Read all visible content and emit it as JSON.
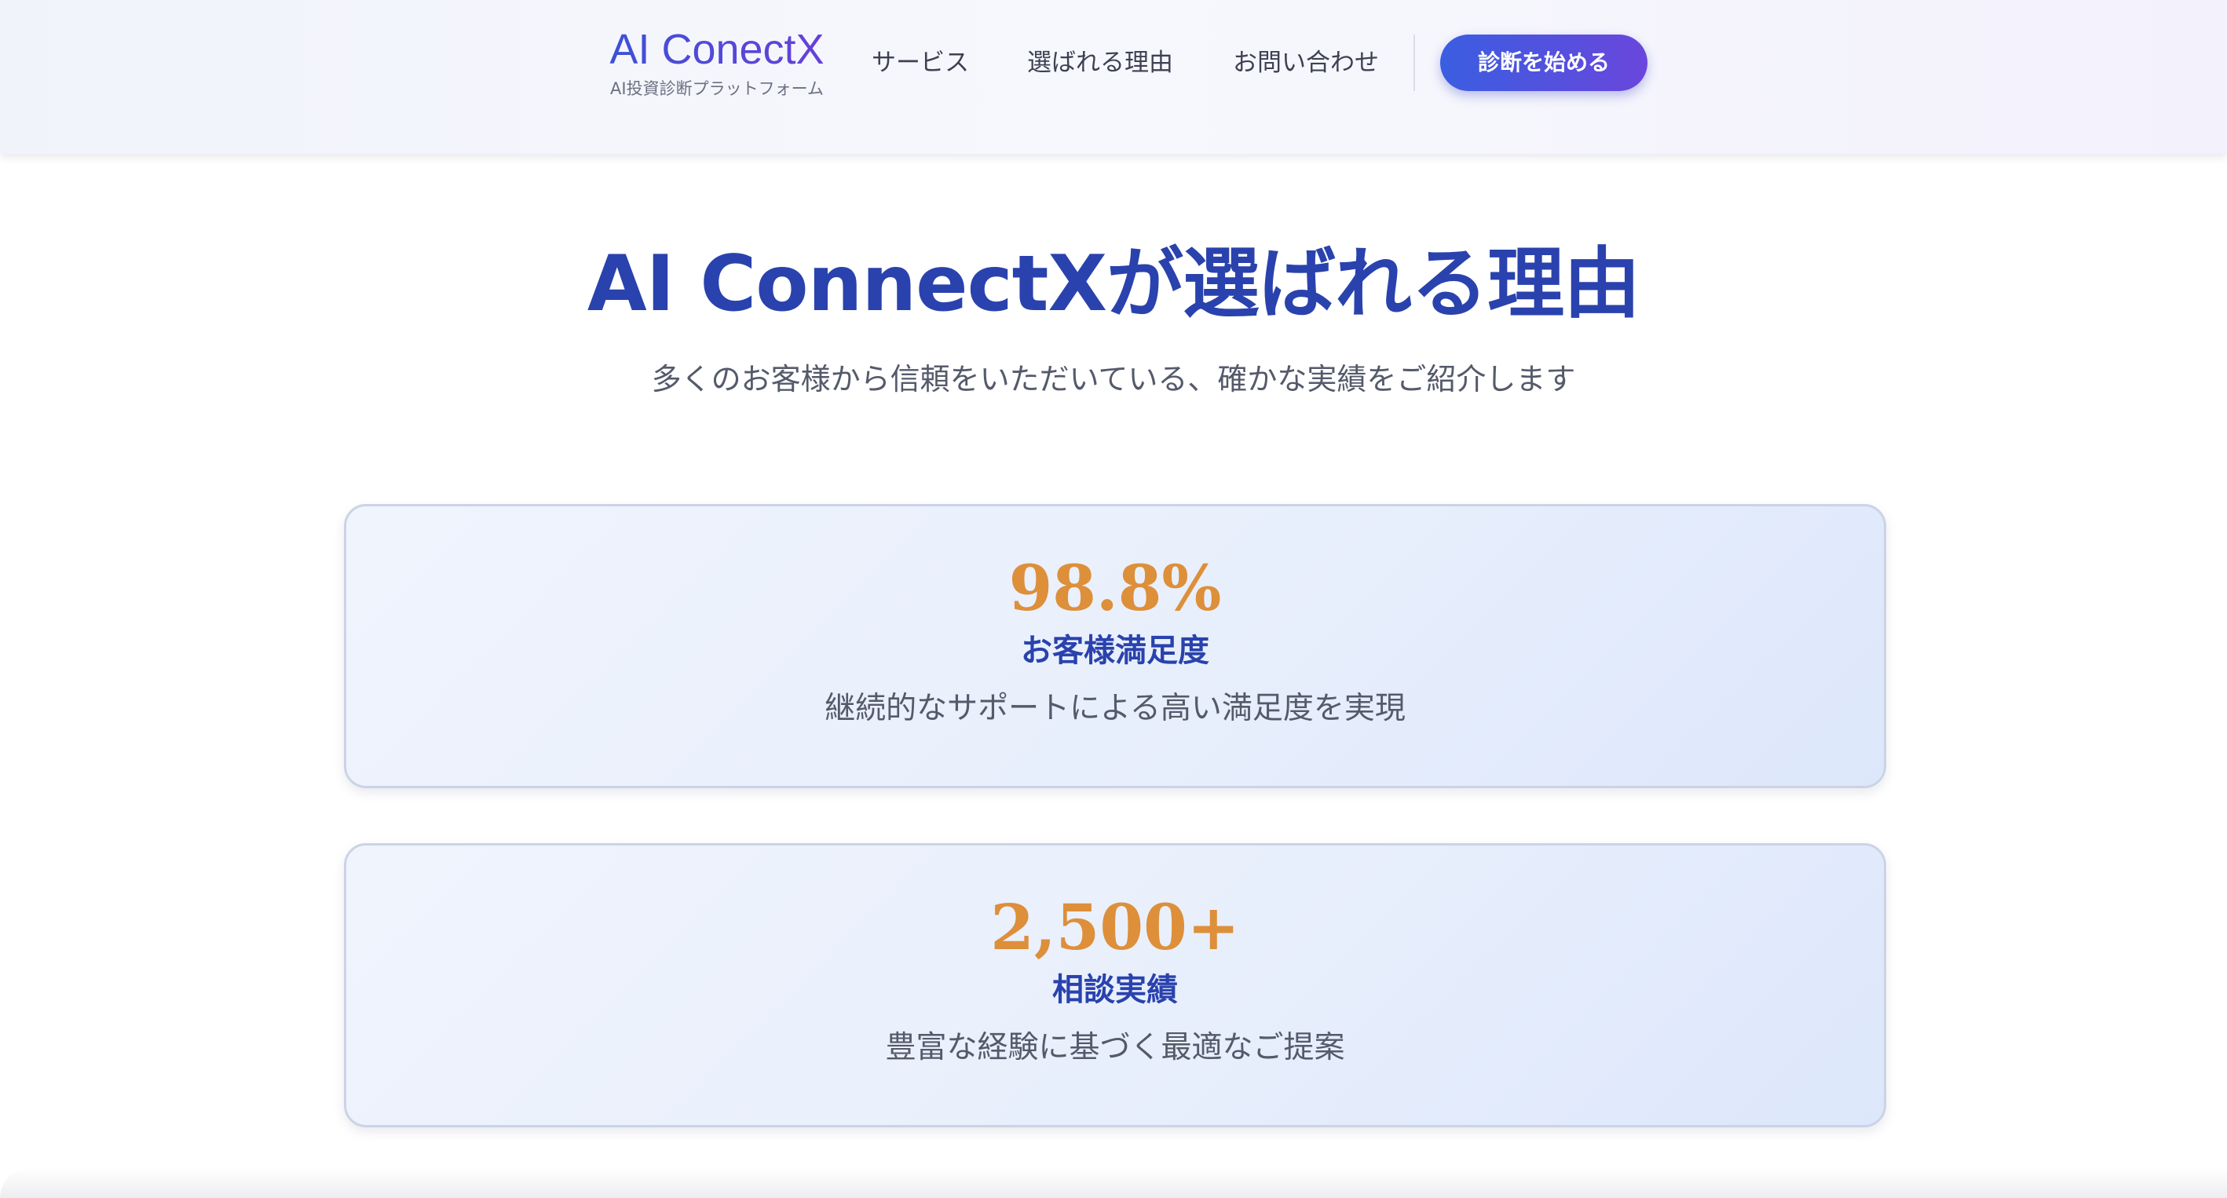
{
  "header": {
    "logo_title": "AI ConectX",
    "logo_subtitle": "AI投資診断プラットフォーム",
    "nav": [
      {
        "label": "サービス"
      },
      {
        "label": "選ばれる理由"
      },
      {
        "label": "お問い合わせ"
      }
    ],
    "cta_label": "診断を始める"
  },
  "section": {
    "title": "AI ConnectXが選ばれる理由",
    "subtitle": "多くのお客様から信頼をいただいている、確かな実績をご紹介します"
  },
  "stats": [
    {
      "value": "98.8%",
      "label": "お客様満足度",
      "description": "継続的なサポートによる高い満足度を実現"
    },
    {
      "value": "2,500+",
      "label": "相談実績",
      "description": "豊富な経験に基づく最適なご提案"
    }
  ],
  "colors": {
    "brand_blue": "#2a42ad",
    "accent_orange": "#dd8f3a",
    "cta_gradient_start": "#3a5ee0",
    "cta_gradient_end": "#6a46dc"
  }
}
